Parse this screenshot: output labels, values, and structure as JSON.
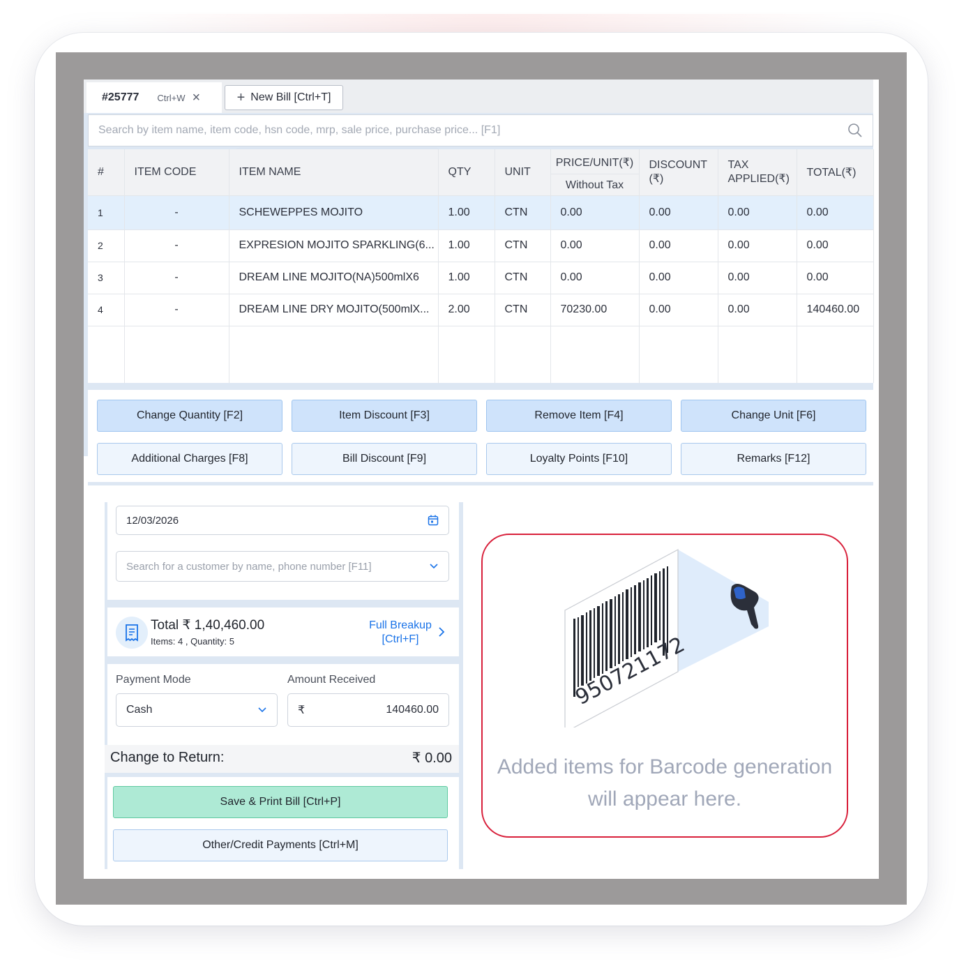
{
  "tabs": {
    "active_bill": "#25777",
    "active_shortcut": "Ctrl+W",
    "new_bill_label": "New Bill [Ctrl+T]"
  },
  "search": {
    "placeholder": "Search by item name, item code, hsn code, mrp, sale price, purchase price... [F1]"
  },
  "table": {
    "headers": {
      "index": "#",
      "item_code": "ITEM CODE",
      "item_name": "ITEM NAME",
      "qty": "QTY",
      "unit": "UNIT",
      "price_unit": "PRICE/UNIT(₹)",
      "price_sub": "Without Tax",
      "discount_1": "DISCOUNT",
      "discount_2": "(₹)",
      "tax_1": "TAX",
      "tax_2": "APPLIED(₹)",
      "total": "TOTAL(₹)"
    },
    "rows": [
      {
        "index": "1",
        "code": "-",
        "name": "SCHEWEPPES MOJITO",
        "qty": "1.00",
        "unit": "CTN",
        "price": "0.00",
        "discount": "0.00",
        "tax": "0.00",
        "total": "0.00"
      },
      {
        "index": "2",
        "code": "-",
        "name": "EXPRESION MOJITO SPARKLING(6...",
        "qty": "1.00",
        "unit": "CTN",
        "price": "0.00",
        "discount": "0.00",
        "tax": "0.00",
        "total": "0.00"
      },
      {
        "index": "3",
        "code": "-",
        "name": "DREAM LINE MOJITO(NA)500mlX6",
        "qty": "1.00",
        "unit": "CTN",
        "price": "0.00",
        "discount": "0.00",
        "tax": "0.00",
        "total": "0.00"
      },
      {
        "index": "4",
        "code": "-",
        "name": "DREAM LINE DRY MOJITO(500mlX...",
        "qty": "2.00",
        "unit": "CTN",
        "price": "70230.00",
        "discount": "0.00",
        "tax": "0.00",
        "total": "140460.00"
      }
    ]
  },
  "actions": {
    "change_quantity": "Change Quantity [F2]",
    "item_discount": "Item Discount [F3]",
    "remove_item": "Remove Item [F4]",
    "change_unit": "Change Unit [F6]",
    "additional_charges": "Additional Charges [F8]",
    "bill_discount": "Bill Discount [F9]",
    "loyalty_points": "Loyalty Points [F10]",
    "remarks": "Remarks [F12]"
  },
  "billing": {
    "date": "12/03/2026",
    "customer_placeholder": "Search for a customer by name, phone number [F11]",
    "total_label": "Total ₹ 1,40,460.00",
    "items_summary": "Items: 4 , Quantity: 5",
    "full_breakup_1": "Full Breakup",
    "full_breakup_2": "[Ctrl+F]",
    "payment_mode_label": "Payment Mode",
    "payment_mode_value": "Cash",
    "amount_received_label": "Amount Received",
    "currency_symbol": "₹",
    "amount_received_value": "140460.00",
    "change_label": "Change to Return:",
    "change_value": "₹ 0.00",
    "save_print": "Save & Print Bill [Ctrl+P]",
    "other_payments": "Other/Credit Payments [Ctrl+M]"
  },
  "barcode_panel": {
    "barcode_number": "950721172",
    "message_1": "Added items for Barcode generation",
    "message_2": "will appear here."
  },
  "colors": {
    "accent": "#1a73e8",
    "selected_row": "#e2effc",
    "primary_button": "#cfe3fb",
    "save_button": "#aeead5",
    "barcode_border": "#d81f3a"
  }
}
